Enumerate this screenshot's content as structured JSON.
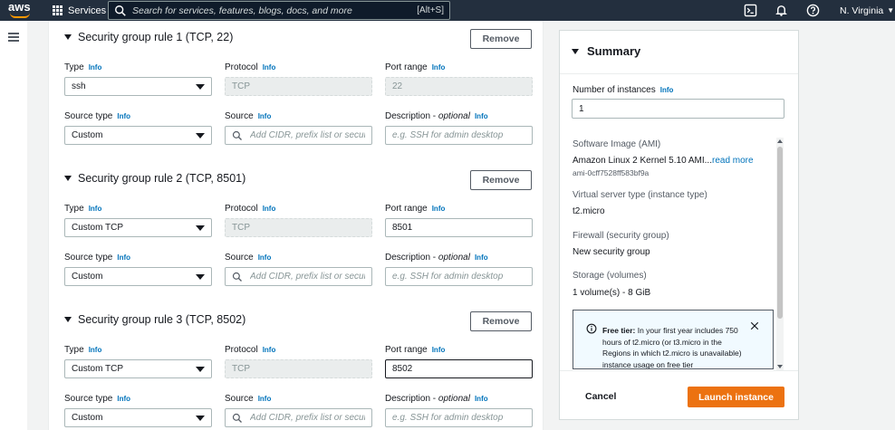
{
  "topnav": {
    "logo_text": "aws",
    "services_label": "Services",
    "search_placeholder": "Search for services, features, blogs, docs, and more",
    "search_shortcut": "[Alt+S]",
    "region_label": "N. Virginia"
  },
  "labels": {
    "type": "Type",
    "protocol": "Protocol",
    "port_range": "Port range",
    "source_type": "Source type",
    "source": "Source",
    "description": "Description",
    "optional": "optional",
    "info": "Info",
    "remove": "Remove"
  },
  "rules": [
    {
      "title": "Security group rule 1 (TCP, 22)",
      "type_value": "ssh",
      "protocol_value": "TCP",
      "port_value": "22",
      "source_type_value": "Custom",
      "source_placeholder": "Add CIDR, prefix list or security",
      "description_placeholder": "e.g. SSH for admin desktop"
    },
    {
      "title": "Security group rule 2 (TCP, 8501)",
      "type_value": "Custom TCP",
      "protocol_value": "TCP",
      "port_value": "8501",
      "source_type_value": "Custom",
      "source_placeholder": "Add CIDR, prefix list or security",
      "description_placeholder": "e.g. SSH for admin desktop"
    },
    {
      "title": "Security group rule 3 (TCP, 8502)",
      "type_value": "Custom TCP",
      "protocol_value": "TCP",
      "port_value": "8502",
      "source_type_value": "Custom",
      "source_placeholder": "Add CIDR, prefix list or security",
      "description_placeholder": "e.g. SSH for admin desktop"
    }
  ],
  "summary": {
    "title": "Summary",
    "instances_label": "Number of instances",
    "instances_info": "Info",
    "instances_value": "1",
    "ami_label": "Software Image (AMI)",
    "ami_value": "Amazon Linux 2 Kernel 5.10 AMI...",
    "ami_link": "read more",
    "ami_id": "ami-0cff7528ff583bf9a",
    "instance_type_label": "Virtual server type (instance type)",
    "instance_type_value": "t2.micro",
    "firewall_label": "Firewall (security group)",
    "firewall_value": "New security group",
    "storage_label": "Storage (volumes)",
    "storage_value": "1 volume(s) - 8 GiB",
    "free_tier_bold": "Free tier:",
    "free_tier_text": " In your first year includes 750 hours of t2.micro (or t3.micro in the Regions in which t2.micro is unavailable) instance usage on free tier",
    "cancel_label": "Cancel",
    "launch_label": "Launch instance"
  },
  "colors": {
    "nav_bg": "#232f3e",
    "accent_orange": "#ec7211",
    "link_blue": "#0073bb"
  }
}
